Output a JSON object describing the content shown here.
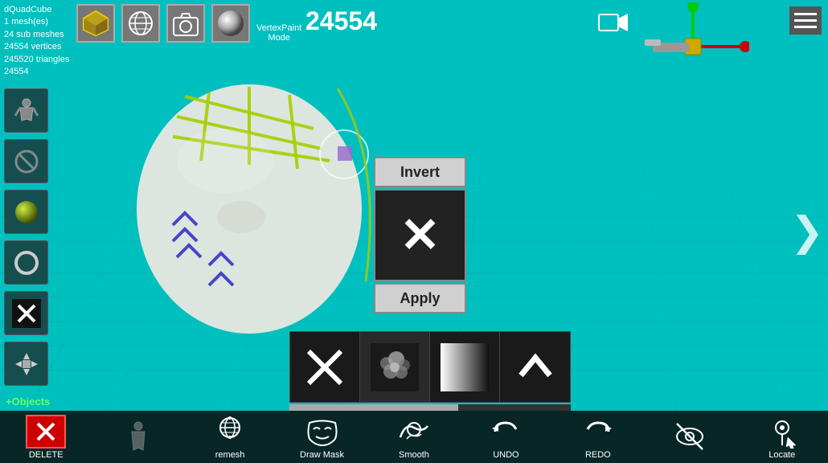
{
  "app": {
    "title": "dQuadCube"
  },
  "topLeft": {
    "objectName": "dQuadCube",
    "meshCount": "1 mesh(es)",
    "subMeshes": "24 sub meshes",
    "vertices": "24554 vertices",
    "triangles": "245520 triangles",
    "id": "24554"
  },
  "vertexCount": "24554",
  "modes": {
    "vertexPaint": "VertexPaint",
    "mode": "Mode"
  },
  "invertPanel": {
    "invertLabel": "Invert",
    "applyLabel": "Apply"
  },
  "brushPanel": {
    "items": [
      {
        "id": "x-brush",
        "label": "X brush"
      },
      {
        "id": "cloud-brush",
        "label": "Cloud brush"
      },
      {
        "id": "gradient-brush",
        "label": "Gradient brush"
      },
      {
        "id": "chevron-brush",
        "label": "Chevron brush"
      }
    ],
    "progressValue": 60
  },
  "bottomToolbar": {
    "tools": [
      {
        "id": "delete",
        "label": "DELETE"
      },
      {
        "id": "figure",
        "label": ""
      },
      {
        "id": "remesh",
        "label": "remesh"
      },
      {
        "id": "draw-mask",
        "label": "Draw Mask"
      },
      {
        "id": "smooth",
        "label": "Smooth"
      },
      {
        "id": "undo",
        "label": "UNDO"
      },
      {
        "id": "redo",
        "label": "REDO"
      },
      {
        "id": "hide",
        "label": ""
      },
      {
        "id": "locate",
        "label": "Locate"
      }
    ]
  },
  "icons": {
    "hamburger": "☰",
    "rightChevron": "❯",
    "xMark": "✕",
    "upChevron": "∧"
  }
}
